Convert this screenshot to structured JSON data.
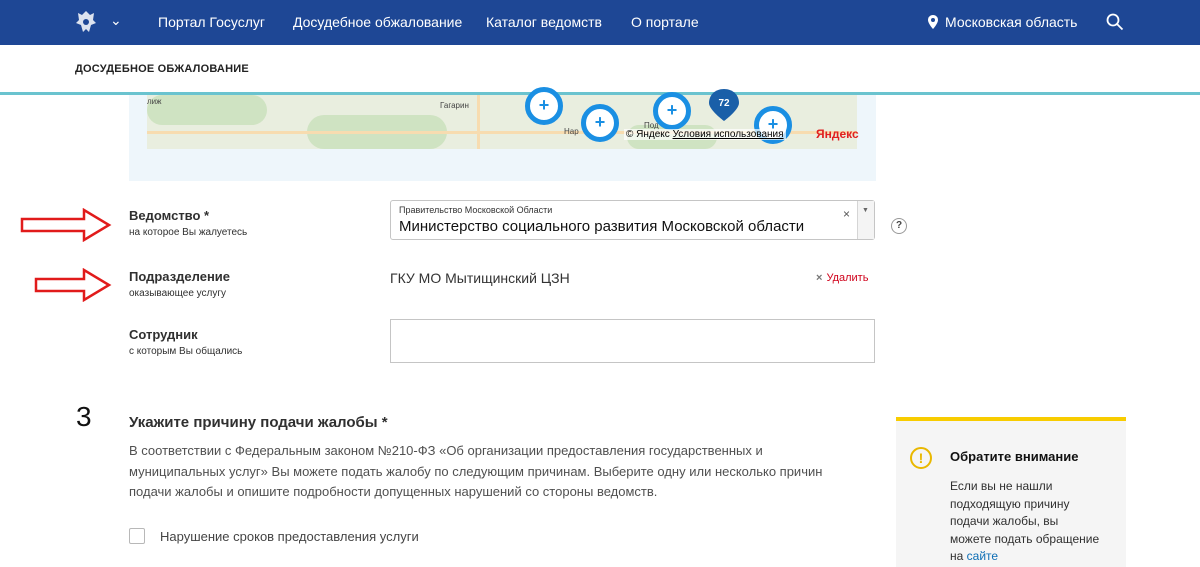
{
  "header": {
    "nav": [
      "Портал Госуслуг",
      "Досудебное обжалование",
      "Каталог ведомств",
      "О портале"
    ],
    "region": "Московская область",
    "colors": {
      "bar": "#1e4795",
      "accent_line": "#6ac3cf"
    }
  },
  "breadcrumb": "ДОСУДЕБНОЕ ОБЖАЛОВАНИЕ",
  "map": {
    "towns": [
      "лиж",
      "Гагарин",
      "Нар",
      "Под"
    ],
    "clusters": [
      "+",
      "+",
      "+",
      "+"
    ],
    "balloon": "72",
    "copyright": "© Яндекс",
    "terms": "Условия использования",
    "logo": "Яндекс"
  },
  "form": {
    "agency_label": "Ведомство *",
    "agency_sub": "на которое Вы жалуетесь",
    "agency_group": "Правительство Московской Области",
    "agency_value": "Министерство социального развития Московской области",
    "clear_glyph": "×",
    "help_glyph": "?",
    "dept_label": "Подразделение",
    "dept_sub": "оказывающее услугу",
    "dept_value": "ГКУ МО Мытищинский ЦЗН",
    "delete_label": "Удалить",
    "employee_label": "Сотрудник",
    "employee_sub": "с которым Вы общались",
    "employee_value": ""
  },
  "step3": {
    "number": "3",
    "title": "Укажите причину подачи жалобы *",
    "text": "В соответствии с Федеральным законом №210-ФЗ «Об организации предоставления государственных и муниципальных услуг» Вы можете подать жалобу по следующим причинам. Выберите одну или несколько причин подачи жалобы и опишите подробности допущенных нарушений со стороны ведомств.",
    "reasons": [
      "Нарушение сроков предоставления услуги"
    ]
  },
  "notice": {
    "title": "Обратите внимание",
    "text": "Если вы не нашли подходящую причину подачи жалобы, вы можете подать обращение на",
    "link": "сайте"
  }
}
